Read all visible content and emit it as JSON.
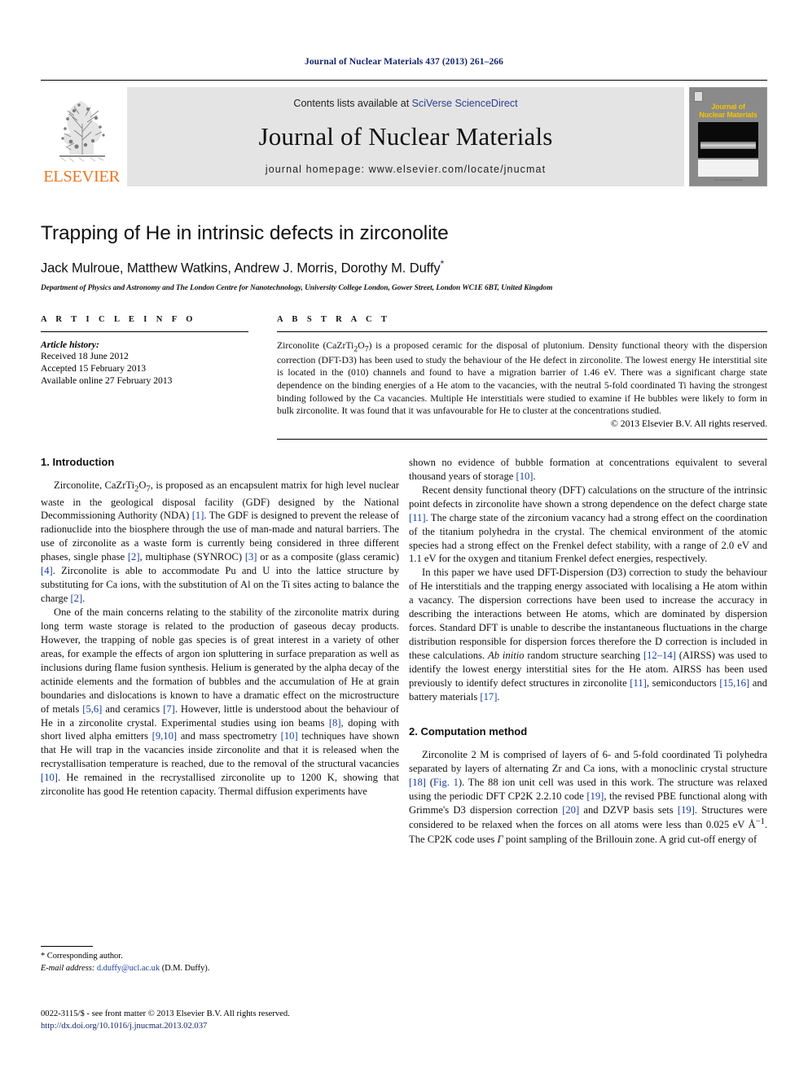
{
  "running_head": "Journal of Nuclear Materials 437 (2013) 261–266",
  "masthead": {
    "contents_prefix": "Contents lists available at ",
    "sciencedirect": "SciVerse ScienceDirect",
    "journal_title": "Journal of Nuclear Materials",
    "homepage": "journal homepage: www.elsevier.com/locate/jnucmat",
    "publisher_wordmark": "ELSEVIER",
    "cover": {
      "line1": "Journal of",
      "line2": "Nuclear Materials",
      "footer_text": "www.elsevier.com/locate/jnucmat"
    }
  },
  "article": {
    "title": "Trapping of He in intrinsic defects in zirconolite",
    "authors": "Jack Mulroue, Matthew Watkins, Andrew J. Morris, Dorothy M. Duffy",
    "corresponding_marker": "*",
    "affiliation": "Department of Physics and Astronomy and The London Centre for Nanotechnology, University College London, Gower Street, London WC1E 6BT, United Kingdom"
  },
  "article_info": {
    "heading": "A R T I C L E   I N F O",
    "history_label": "Article history:",
    "history": [
      "Received 18 June 2012",
      "Accepted 15 February 2013",
      "Available online 27 February 2013"
    ]
  },
  "abstract": {
    "heading": "A B S T R A C T",
    "text": "Zirconolite (CaZrTi2O7) is a proposed ceramic for the disposal of plutonium. Density functional theory with the dispersion correction (DFT-D3) has been used to study the behaviour of the He defect in zirconolite. The lowest energy He interstitial site is located in the (010) channels and found to have a migration barrier of 1.46 eV. There was a significant charge state dependence on the binding energies of a He atom to the vacancies, with the neutral 5-fold coordinated Ti having the strongest binding followed by the Ca vacancies. Multiple He interstitials were studied to examine if He bubbles were likely to form in bulk zirconolite. It was found that it was unfavourable for He to cluster at the concentrations studied.",
    "copyright": "© 2013 Elsevier B.V. All rights reserved."
  },
  "sections": {
    "introduction_heading": "1. Introduction",
    "computation_heading": "2. Computation method"
  },
  "body": {
    "intro_p1": "Zirconolite, CaZrTi2O7, is proposed as an encapsulent matrix for high level nuclear waste in the geological disposal facility (GDF) designed by the National Decommissioning Authority (NDA) [1]. The GDF is designed to prevent the release of radionuclide into the biosphere through the use of man-made and natural barriers. The use of zirconolite as a waste form is currently being considered in three different phases, single phase [2], multiphase (SYNROC) [3] or as a composite (glass ceramic) [4]. Zirconolite is able to accommodate Pu and U into the lattice structure by substituting for Ca ions, with the substitution of Al on the Ti sites acting to balance the charge [2].",
    "intro_p2": "One of the main concerns relating to the stability of the zirconolite matrix during long term waste storage is related to the production of gaseous decay products. However, the trapping of noble gas species is of great interest in a variety of other areas, for example the effects of argon ion spluttering in surface preparation as well as inclusions during flame fusion synthesis. Helium is generated by the alpha decay of the actinide elements and the formation of bubbles and the accumulation of He at grain boundaries and dislocations is known to have a dramatic effect on the microstructure of metals [5,6] and ceramics [7]. However, little is understood about the behaviour of He in a zirconolite crystal. Experimental studies using ion beams [8], doping with short lived alpha emitters [9,10] and mass spectrometry [10] techniques have shown that He will trap in the vacancies inside zirconolite and that it is released when the recrystallisation temperature is reached, due to the removal of the structural vacancies [10]. He remained in the recrystallised zirconolite up to 1200 K, showing that zirconolite has good He retention capacity. Thermal diffusion experiments have",
    "right_p1_cont": "shown no evidence of bubble formation at concentrations equivalent to several thousand years of storage [10].",
    "right_p2": "Recent density functional theory (DFT) calculations on the structure of the intrinsic point defects in zirconolite have shown a strong dependence on the defect charge state [11]. The charge state of the zirconium vacancy had a strong effect on the coordination of the titanium polyhedra in the crystal. The chemical environment of the atomic species had a strong effect on the Frenkel defect stability, with a range of 2.0 eV and 1.1 eV for the oxygen and titanium Frenkel defect energies, respectively.",
    "right_p3": "In this paper we have used DFT-Dispersion (D3) correction to study the behaviour of He interstitials and the trapping energy associated with localising a He atom within a vacancy. The dispersion corrections have been used to increase the accuracy in describing the interactions between He atoms, which are dominated by dispersion forces. Standard DFT is unable to describe the instantaneous fluctuations in the charge distribution responsible for dispersion forces therefore the D correction is included in these calculations. Ab initio random structure searching [12–14] (AIRSS) was used to identify the lowest energy interstitial sites for the He atom. AIRSS has been used previously to identify defect structures in zirconolite [11], semiconductors [15,16] and battery materials [17].",
    "comp_p1": "Zirconolite 2 M is comprised of layers of 6- and 5-fold coordinated Ti polyhedra separated by layers of alternating Zr and Ca ions, with a monoclinic crystal structure [18] (Fig. 1). The 88 ion unit cell was used in this work. The structure was relaxed using the periodic DFT CP2K 2.2.10 code [19], the revised PBE functional along with Grimme's D3 dispersion correction [20] and DZVP basis sets [19]. Structures were considered to be relaxed when the forces on all atoms were less than 0.025 eV Å−1. The CP2K code uses Γ point sampling of the Brillouin zone. A grid cut-off energy of"
  },
  "footnote": {
    "corresponding": "* Corresponding author.",
    "email_label": "E-mail address:",
    "email": "d.duffy@ucl.ac.uk",
    "email_owner": "(D.M. Duffy)."
  },
  "colophon": {
    "issn_line": "0022-3115/$ - see front matter © 2013 Elsevier B.V. All rights reserved.",
    "doi": "http://dx.doi.org/10.1016/j.jnucmat.2013.02.037"
  },
  "colors": {
    "link_blue": "#1a3d9c",
    "runhead_blue": "#16256b",
    "elsevier_orange": "#e87722",
    "band_gray": "#e4e4e4",
    "cover_yellow": "#f2c500"
  }
}
